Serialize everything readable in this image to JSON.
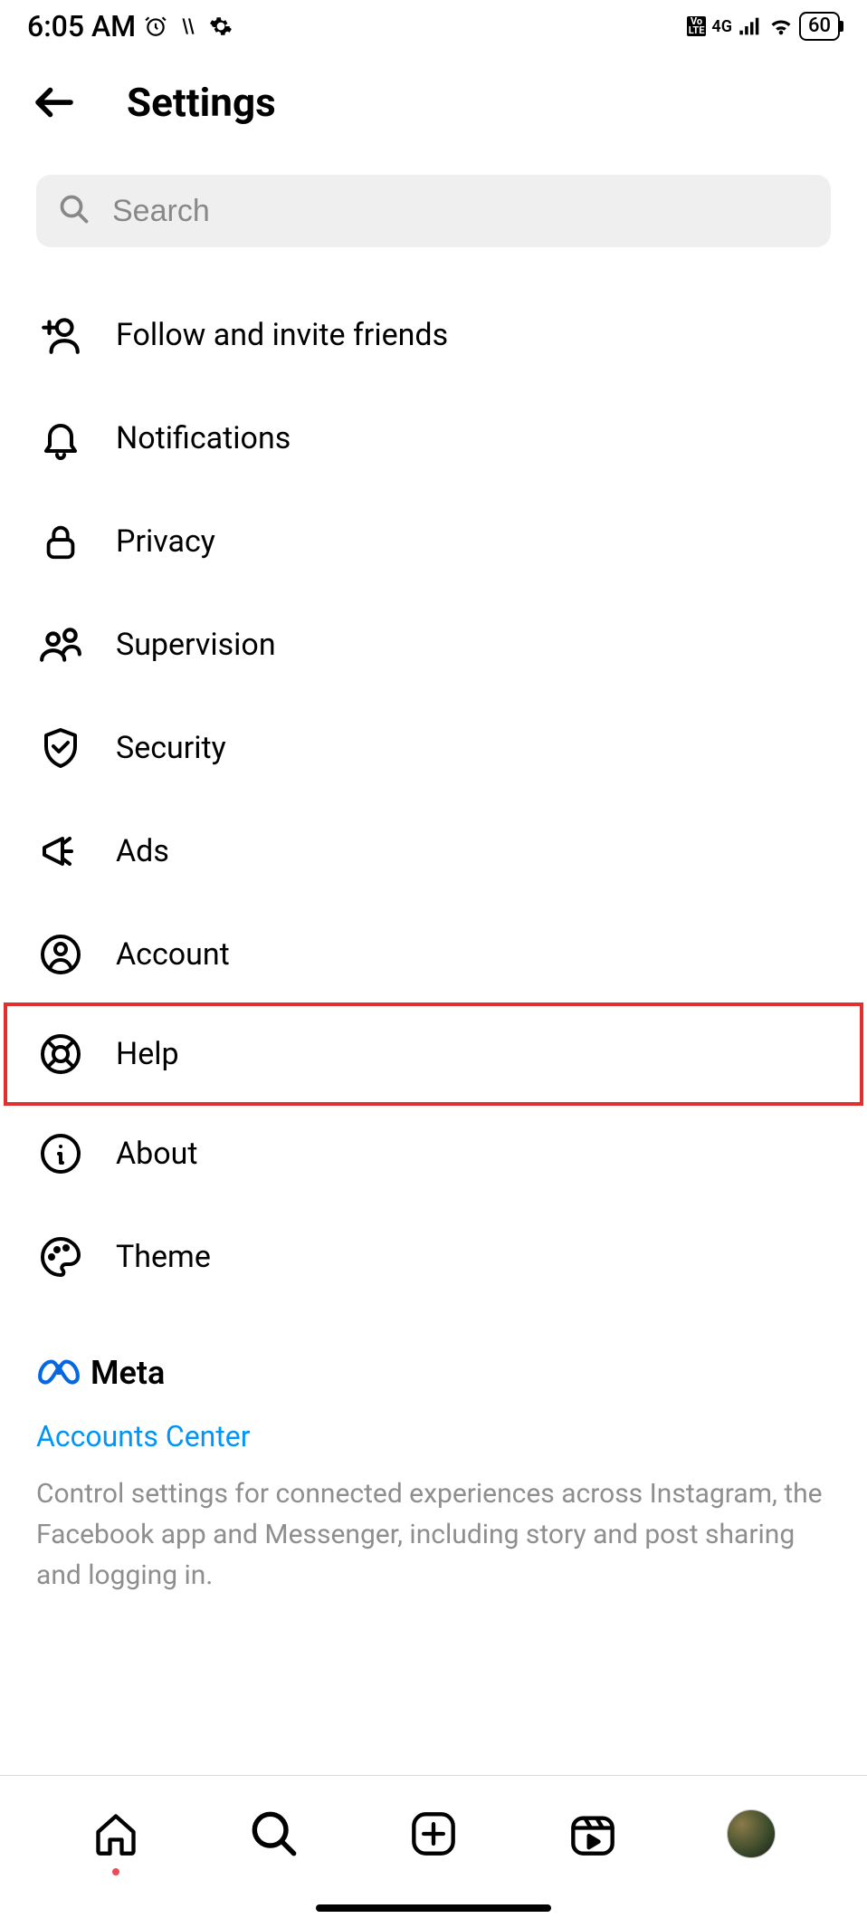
{
  "status": {
    "time": "6:05 AM",
    "network_label_top": "Vo",
    "network_label_bottom": "LTE",
    "network_type": "4G",
    "battery": "60"
  },
  "header": {
    "title": "Settings"
  },
  "search": {
    "placeholder": "Search"
  },
  "items": [
    {
      "icon": "add-person-icon",
      "label": "Follow and invite friends"
    },
    {
      "icon": "bell-icon",
      "label": "Notifications"
    },
    {
      "icon": "lock-icon",
      "label": "Privacy"
    },
    {
      "icon": "people-icon",
      "label": "Supervision"
    },
    {
      "icon": "shield-check-icon",
      "label": "Security"
    },
    {
      "icon": "megaphone-icon",
      "label": "Ads"
    },
    {
      "icon": "account-icon",
      "label": "Account"
    },
    {
      "icon": "lifebuoy-icon",
      "label": "Help",
      "highlight": true
    },
    {
      "icon": "info-icon",
      "label": "About"
    },
    {
      "icon": "palette-icon",
      "label": "Theme"
    }
  ],
  "meta": {
    "brand": "Meta",
    "link": "Accounts Center",
    "description": "Control settings for connected experiences across Instagram, the Facebook app and Messenger, including story and post sharing and logging in."
  }
}
